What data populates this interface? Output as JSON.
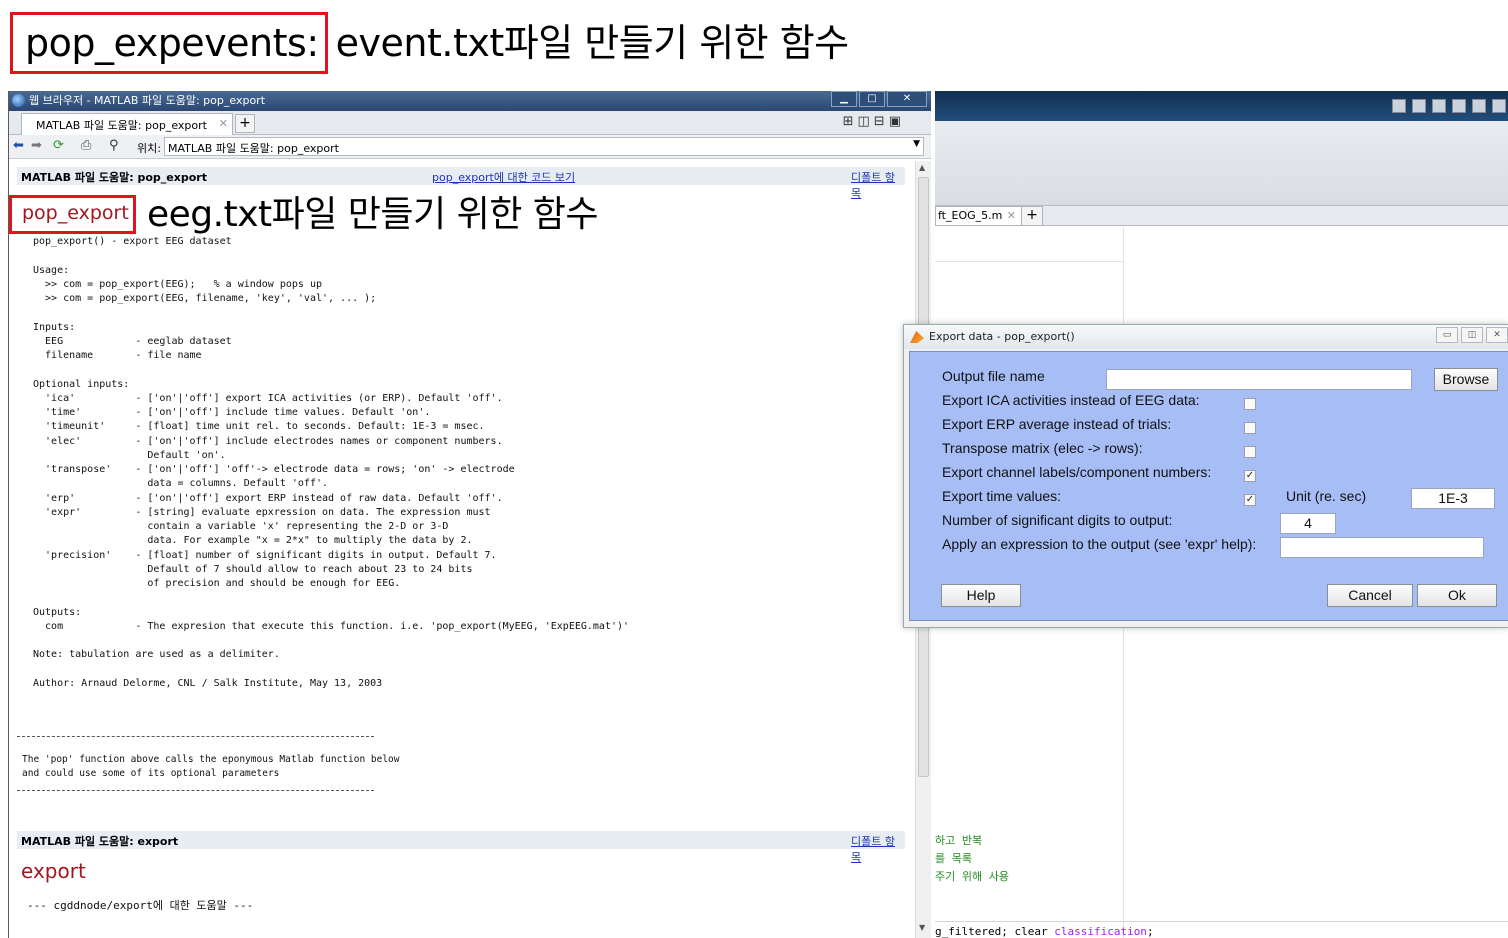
{
  "slide": {
    "title_highlight": "pop_expevents:",
    "title_rest": "event.txt파일 만들기 위한 함수"
  },
  "browser": {
    "window_title": "웹 브라우저 - MATLAB 파일 도움말: pop_export",
    "tab_label": "MATLAB 파일 도움말: pop_export",
    "tab_close": "✕",
    "tab_add": "+",
    "location_label": "위치:",
    "location_value": "MATLAB 파일 도움말: pop_export",
    "helpbar1": {
      "title": "MATLAB 파일 도움말: pop_export",
      "code_link": "pop_export에 대한 코드 보기",
      "default_link": "디폴트 항목"
    },
    "func_name": "pop_export",
    "note": "eeg.txt파일 만들기 위한 함수",
    "help_text": "pop_export() - export EEG dataset\n\nUsage:\n  >> com = pop_export(EEG);   % a window pops up\n  >> com = pop_export(EEG, filename, 'key', 'val', ... );\n\nInputs:\n  EEG            - eeglab dataset\n  filename       - file name\n\nOptional inputs:\n  'ica'          - ['on'|'off'] export ICA activities (or ERP). Default 'off'.\n  'time'         - ['on'|'off'] include time values. Default 'on'.\n  'timeunit'     - [float] time unit rel. to seconds. Default: 1E-3 = msec.\n  'elec'         - ['on'|'off'] include electrodes names or component numbers.\n                   Default 'on'.\n  'transpose'    - ['on'|'off'] 'off'-> electrode data = rows; 'on' -> electrode\n                   data = columns. Default 'off'.\n  'erp'          - ['on'|'off'] export ERP instead of raw data. Default 'off'.\n  'expr'         - [string] evaluate epxression on data. The expression must\n                   contain a variable 'x' representing the 2-D or 3-D\n                   data. For example \"x = 2*x\" to multiply the data by 2.\n  'precision'    - [float] number of significant digits in output. Default 7.\n                   Default of 7 should allow to reach about 23 to 24 bits\n                   of precision and should be enough for EEG.\n\nOutputs:\n  com            - The expresion that execute this function. i.e. 'pop_export(MyEEG, 'ExpEEG.mat')'\n\nNote: tabulation are used as a delimiter.\n\nAuthor: Arnaud Delorme, CNL / Salk Institute, May 13, 2003",
    "pop_note": "The 'pop' function above calls the eponymous Matlab function below\nand could use some of its optional parameters",
    "helpbar2": {
      "title": "MATLAB 파일 도움말: export",
      "default_link": "디폴트 항목"
    },
    "func_name2": "export",
    "help_text2": "--- cgddnode/export에 대한 도움말 ---"
  },
  "editor": {
    "tab_label": "ft_EOG_5.m",
    "tab_close": "✕",
    "tab_add": "+",
    "comments": [
      "하고 반복",
      "를 목록",
      "주기 위해 사용"
    ],
    "code_line_plain1": "g_filtered; clear ",
    "code_line_var": "classification",
    "code_line_plain2": ";"
  },
  "dialog": {
    "title": "Export data - pop_export()",
    "labels": {
      "output_file": "Output file name",
      "export_ica": "Export ICA activities instead of EEG data:",
      "export_erp": "Export ERP average instead of trials:",
      "transpose": "Transpose matrix (elec -> rows):",
      "channel_labels": "Export channel labels/component numbers:",
      "time_values": "Export time values:",
      "unit": "Unit (re. sec)",
      "sig_digits": "Number of significant digits to output:",
      "expression": "Apply an expression to the output (see 'expr' help):"
    },
    "checks": {
      "export_ica": "",
      "export_erp": "",
      "transpose": "",
      "channel_labels": "✓",
      "time_values": "✓"
    },
    "values": {
      "output_file": "",
      "unit": "1E-3",
      "sig_digits": "4",
      "expression": ""
    },
    "buttons": {
      "browse": "Browse",
      "help": "Help",
      "cancel": "Cancel",
      "ok": "Ok"
    }
  }
}
